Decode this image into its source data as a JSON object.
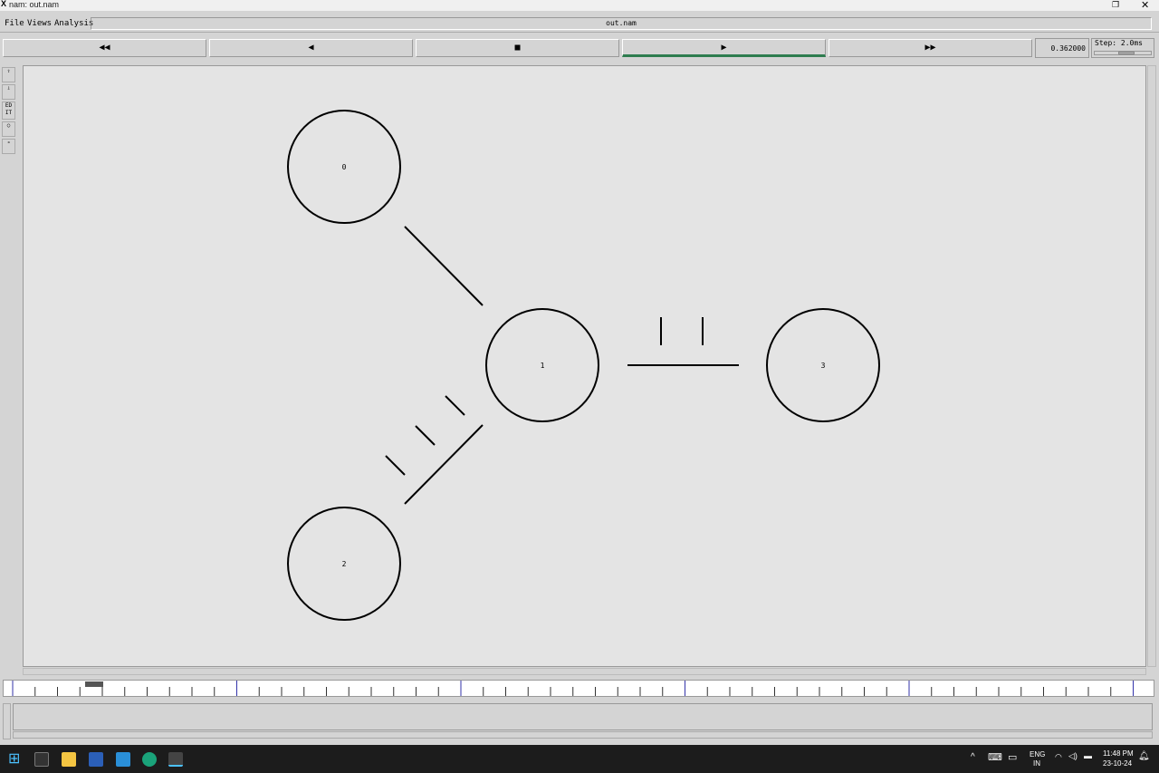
{
  "window": {
    "title": "nam: out.nam",
    "file": "out.nam"
  },
  "menu": [
    "File",
    "Views",
    "Analysis"
  ],
  "controls": {
    "rewind": "◀◀",
    "back": "◀",
    "stop": "■",
    "play": "▶",
    "forward": "▶▶",
    "time": "0.362000",
    "step": "Step: 2.0ms"
  },
  "sidebar": {
    "edit": "ED IT"
  },
  "nodes": [
    {
      "id": "0"
    },
    {
      "id": "1"
    },
    {
      "id": "2"
    },
    {
      "id": "3"
    }
  ],
  "colors": {
    "play_active": "#2e7d4f",
    "timeline_major": "#3333aa"
  },
  "taskbar": {
    "lang": "ENG",
    "region": "IN",
    "time": "11:48 PM",
    "date": "23-10-24"
  }
}
